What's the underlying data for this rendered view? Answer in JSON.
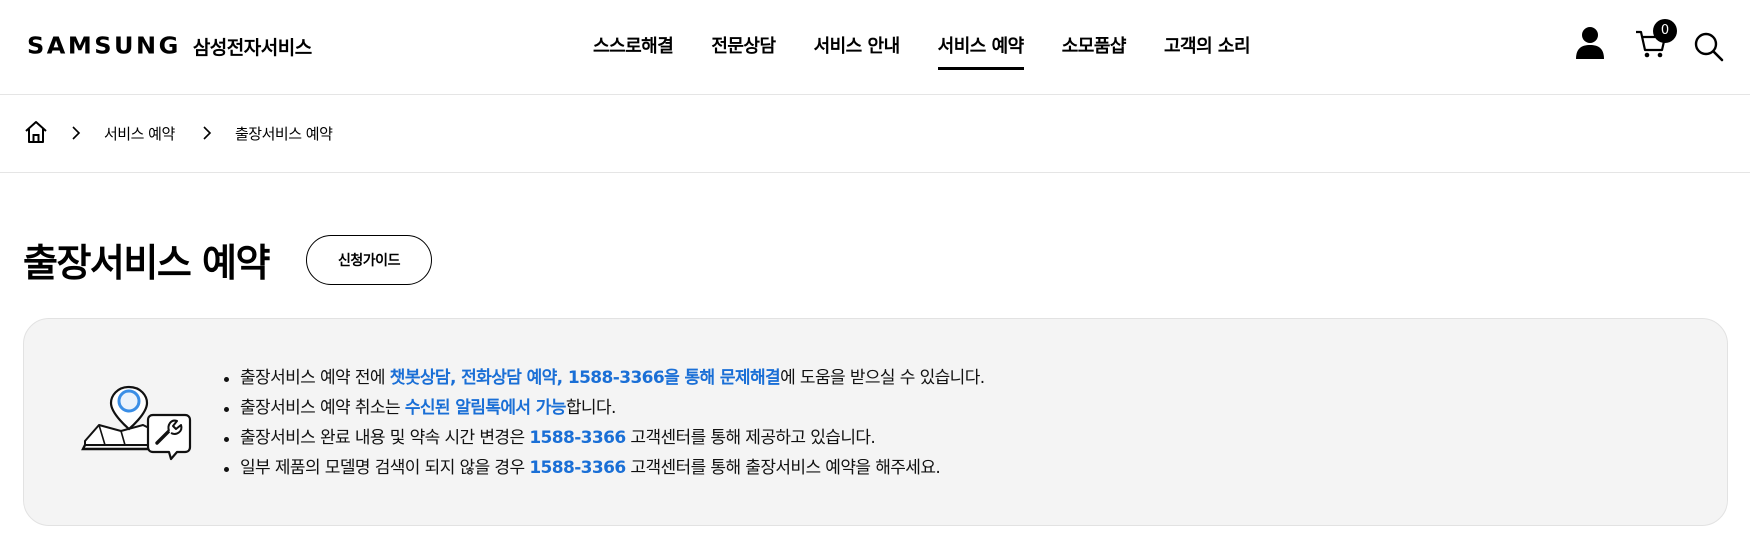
{
  "header": {
    "logo_word": "SAMSUNG",
    "logo_sub": "삼성전자서비스",
    "nav": [
      {
        "label": "스스로해결",
        "active": false
      },
      {
        "label": "전문상담",
        "active": false
      },
      {
        "label": "서비스 안내",
        "active": false
      },
      {
        "label": "서비스 예약",
        "active": true
      },
      {
        "label": "소모품샵",
        "active": false
      },
      {
        "label": "고객의 소리",
        "active": false
      }
    ],
    "cart_count": "0",
    "icons": [
      "user-icon",
      "cart-icon",
      "search-icon"
    ]
  },
  "breadcrumb": {
    "icon": "home-icon",
    "items": [
      "서비스 예약",
      "출장서비스 예약"
    ]
  },
  "page": {
    "title": "출장서비스 예약",
    "guide_button": "신청가이드"
  },
  "notice": {
    "icon": "map-pin-repair-icon",
    "accent_color": "#1a6fd6",
    "items": [
      {
        "pre": "출장서비스 예약 전에 ",
        "hl": "챗봇상담, 전화상담 예약, 1588-3366을 통해 문제해결",
        "post": "에 도움을 받으실 수 있습니다."
      },
      {
        "pre": "출장서비스 예약 취소는 ",
        "hl": "수신된 알림톡에서 가능",
        "post": "합니다."
      },
      {
        "pre": "출장서비스 완료 내용 및 약속 시간 변경은 ",
        "hl": "1588-3366",
        "post": " 고객센터를 통해 제공하고 있습니다."
      },
      {
        "pre": "일부 제품의 모델명 검색이 되지 않을 경우 ",
        "hl": "1588-3366",
        "post": " 고객센터를 통해 출장서비스 예약을 해주세요."
      }
    ]
  }
}
